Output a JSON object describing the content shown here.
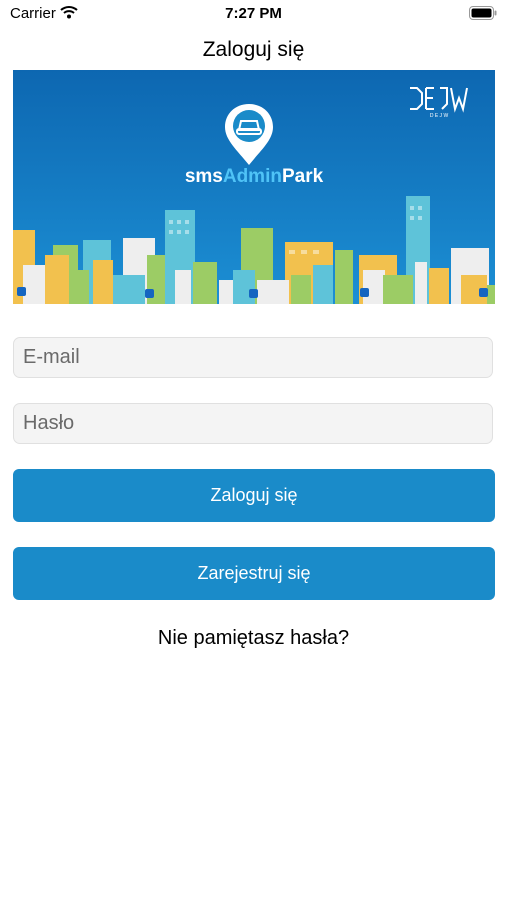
{
  "status_bar": {
    "carrier": "Carrier",
    "time": "7:27 PM"
  },
  "nav": {
    "title": "Zaloguj się"
  },
  "banner": {
    "app_name_prefix": "sms",
    "app_name_highlight": "Admin",
    "app_name_suffix": "Park",
    "dejw_letters": "D E J W",
    "sky_color": "#1377c2",
    "highlight_color": "#4fc3f7"
  },
  "form": {
    "email_placeholder": "E-mail",
    "password_placeholder": "Hasło",
    "login_label": "Zaloguj się",
    "register_label": "Zarejestruj się",
    "forgot_label": "Nie pamiętasz hasła?"
  },
  "icons": [
    "wifi-icon",
    "battery-icon",
    "location-pin-icon",
    "car-icon",
    "parking-sign-icon"
  ],
  "colors": {
    "button": "#1a8bc9",
    "input_bg": "#f4f4f4"
  }
}
